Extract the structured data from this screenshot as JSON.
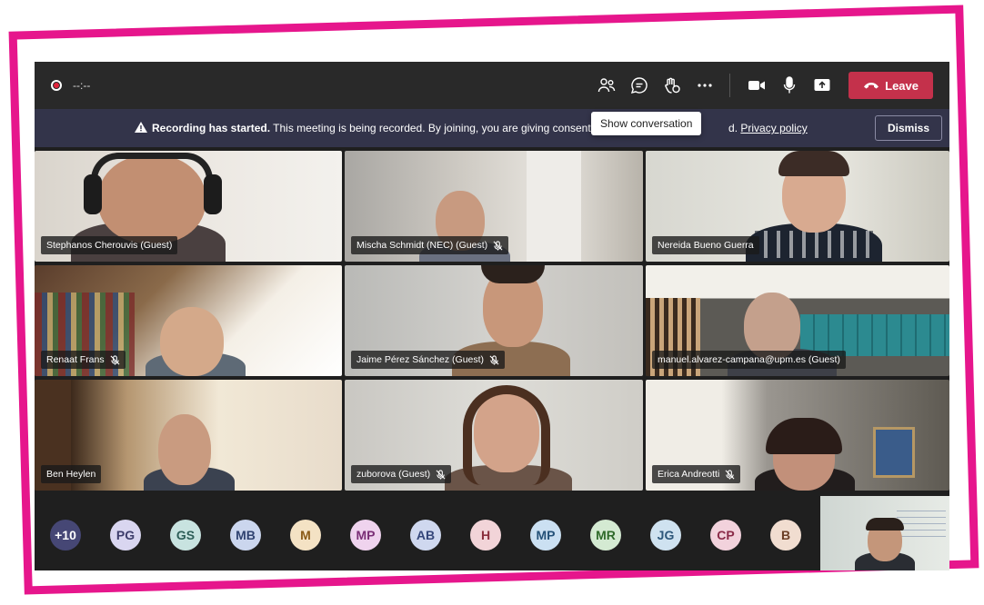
{
  "topbar": {
    "timer": "--:--",
    "leave_label": "Leave"
  },
  "banner": {
    "strong": "Recording has started.",
    "text": " This meeting is being recorded. By joining, you are giving consent for this",
    "text_tail": "d.",
    "privacy_link": "Privacy policy",
    "dismiss_label": "Dismiss"
  },
  "tooltip": "Show conversation",
  "participants": [
    {
      "name": "Stephanos Cherouvis (Guest)",
      "muted": false
    },
    {
      "name": "Mischa Schmidt (NEC) (Guest)",
      "muted": true
    },
    {
      "name": "Nereida Bueno Guerra",
      "muted": false
    },
    {
      "name": "Renaat Frans",
      "muted": true
    },
    {
      "name": "Jaime Pérez Sánchez (Guest)",
      "muted": true
    },
    {
      "name": "manuel.alvarez-campana@upm.es (Guest)",
      "muted": false
    },
    {
      "name": "Ben Heylen",
      "muted": false
    },
    {
      "name": "zuborova (Guest)",
      "muted": true
    },
    {
      "name": "Erica Andreotti",
      "muted": true
    }
  ],
  "avatars": [
    {
      "initials": "+10",
      "bg": "#464775",
      "fg": "#ffffff"
    },
    {
      "initials": "PG",
      "bg": "#d9d6f0",
      "fg": "#3d3d6b"
    },
    {
      "initials": "GS",
      "bg": "#c8e3e0",
      "fg": "#2d5e58"
    },
    {
      "initials": "MB",
      "bg": "#cbd6ee",
      "fg": "#2f4270"
    },
    {
      "initials": "M",
      "bg": "#f4e2c4",
      "fg": "#8a5a16"
    },
    {
      "initials": "MP",
      "bg": "#efd3ee",
      "fg": "#7a2e76"
    },
    {
      "initials": "AB",
      "bg": "#cfd8ef",
      "fg": "#34467a"
    },
    {
      "initials": "H",
      "bg": "#f2d4d8",
      "fg": "#8a2e3c"
    },
    {
      "initials": "MP",
      "bg": "#cbe0f2",
      "fg": "#245178"
    },
    {
      "initials": "MR",
      "bg": "#d4ead2",
      "fg": "#2f6a2a"
    },
    {
      "initials": "JG",
      "bg": "#cfe2f0",
      "fg": "#2d577a"
    },
    {
      "initials": "CP",
      "bg": "#f2d2dc",
      "fg": "#8a2a48"
    },
    {
      "initials": "B",
      "bg": "#f1ddd0",
      "fg": "#6b3f26"
    }
  ],
  "icons": {
    "participants": "people-icon",
    "chat": "chat-icon",
    "reactions": "raise-hand-icon",
    "more": "more-icon",
    "camera": "camera-icon",
    "mic": "microphone-icon",
    "share": "share-screen-icon",
    "hangup": "phone-hangup-icon",
    "recording": "recording-icon",
    "warning": "warning-icon"
  },
  "colors": {
    "accent_pink": "#e6168c",
    "leave_red": "#c4314b",
    "banner_bg": "#33344a"
  }
}
